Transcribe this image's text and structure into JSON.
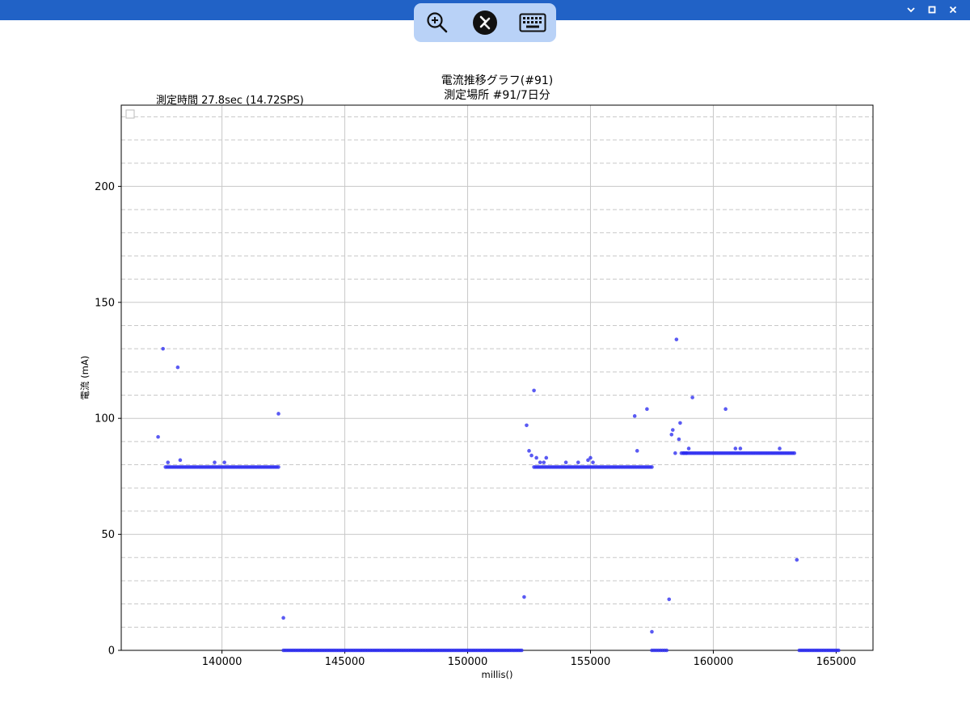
{
  "window": {
    "controls": [
      {
        "name": "minimize",
        "icon": "chevron-down-icon"
      },
      {
        "name": "maximize",
        "icon": "square-icon"
      },
      {
        "name": "close",
        "icon": "close-icon"
      }
    ],
    "bar_color": "#2162c6"
  },
  "toolbar": {
    "tools": [
      {
        "name": "zoom",
        "icon": "zoom-in-icon"
      },
      {
        "name": "remote-desktop",
        "icon": "remote-desktop-icon"
      },
      {
        "name": "keyboard",
        "icon": "keyboard-icon"
      }
    ]
  },
  "chart_data": {
    "type": "scatter",
    "title_line1": "電流推移グラフ(#91)",
    "title_line2": "測定場所 #91/7日分",
    "info": "測定時間  27.8sec (14.72SPS)",
    "xlabel": "millis()",
    "ylabel": "電流 (mA)",
    "xlim": [
      135900,
      166500
    ],
    "ylim": [
      0,
      235
    ],
    "xticks": [
      140000,
      145000,
      150000,
      155000,
      160000,
      165000
    ],
    "yticks": [
      0,
      50,
      100,
      150,
      200
    ],
    "y_dashed_grid": [
      10,
      20,
      30,
      40,
      60,
      70,
      80,
      90,
      110,
      120,
      130,
      140,
      160,
      170,
      180,
      190,
      210,
      220,
      230
    ],
    "grid": true,
    "marker_color": "#2b2bf0",
    "legend": "top-left (empty)",
    "segments": [
      {
        "x0": 137700,
        "x1": 142300,
        "n": 68,
        "y": 79
      },
      {
        "x0": 142500,
        "x1": 152200,
        "n": 140,
        "y": 0
      },
      {
        "x0": 152700,
        "x1": 157500,
        "n": 70,
        "y": 79
      },
      {
        "x0": 157500,
        "x1": 158100,
        "n": 8,
        "y": 0
      },
      {
        "x0": 158700,
        "x1": 163300,
        "n": 68,
        "y": 85
      },
      {
        "x0": 163500,
        "x1": 165100,
        "n": 24,
        "y": 0
      }
    ],
    "points": [
      {
        "x": 137400,
        "y": 92
      },
      {
        "x": 137600,
        "y": 130
      },
      {
        "x": 137800,
        "y": 81
      },
      {
        "x": 138200,
        "y": 122
      },
      {
        "x": 138300,
        "y": 82
      },
      {
        "x": 139700,
        "y": 81
      },
      {
        "x": 140100,
        "y": 81
      },
      {
        "x": 142300,
        "y": 102
      },
      {
        "x": 142500,
        "y": 14
      },
      {
        "x": 152300,
        "y": 23
      },
      {
        "x": 152400,
        "y": 97
      },
      {
        "x": 152500,
        "y": 86
      },
      {
        "x": 152600,
        "y": 84
      },
      {
        "x": 152700,
        "y": 112
      },
      {
        "x": 152800,
        "y": 83
      },
      {
        "x": 152950,
        "y": 81
      },
      {
        "x": 153100,
        "y": 81
      },
      {
        "x": 153200,
        "y": 83
      },
      {
        "x": 154000,
        "y": 81
      },
      {
        "x": 154500,
        "y": 81
      },
      {
        "x": 154900,
        "y": 82
      },
      {
        "x": 155000,
        "y": 83
      },
      {
        "x": 155100,
        "y": 81
      },
      {
        "x": 156800,
        "y": 101
      },
      {
        "x": 156900,
        "y": 86
      },
      {
        "x": 157300,
        "y": 104
      },
      {
        "x": 157500,
        "y": 8
      },
      {
        "x": 158200,
        "y": 22
      },
      {
        "x": 158300,
        "y": 93
      },
      {
        "x": 158350,
        "y": 95
      },
      {
        "x": 158450,
        "y": 85
      },
      {
        "x": 158500,
        "y": 134
      },
      {
        "x": 158600,
        "y": 91
      },
      {
        "x": 158650,
        "y": 98
      },
      {
        "x": 158800,
        "y": 85
      },
      {
        "x": 158900,
        "y": 85
      },
      {
        "x": 159000,
        "y": 87
      },
      {
        "x": 159150,
        "y": 109
      },
      {
        "x": 160500,
        "y": 104
      },
      {
        "x": 160900,
        "y": 87
      },
      {
        "x": 161100,
        "y": 87
      },
      {
        "x": 162700,
        "y": 87
      },
      {
        "x": 163400,
        "y": 39
      }
    ]
  }
}
